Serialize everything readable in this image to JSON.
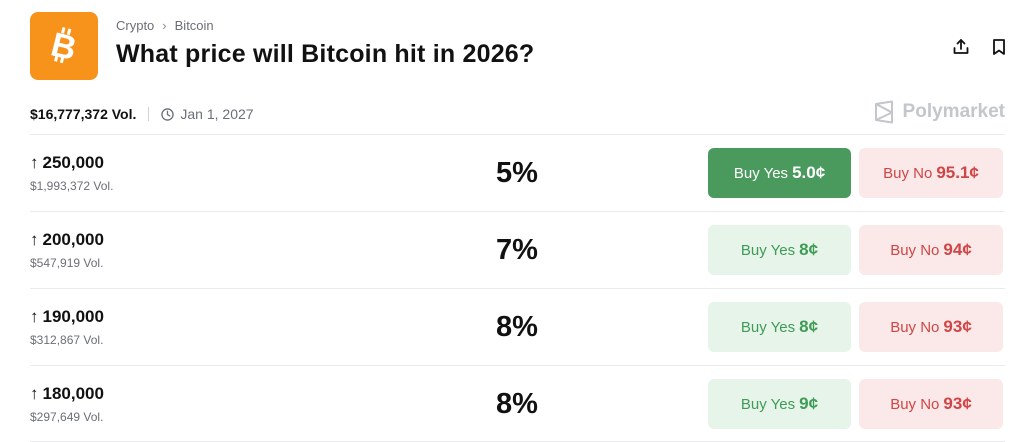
{
  "market": {
    "breadcrumb": [
      "Crypto",
      "Bitcoin"
    ],
    "title": "What price will Bitcoin hit in 2026?",
    "volume": "$16,777,372 Vol.",
    "end_date": "Jan 1, 2027",
    "brand": "Polymarket",
    "icons": {
      "logo": "bitcoin-logo-icon",
      "share": "share-icon",
      "bookmark": "bookmark-icon",
      "clock": "clock-icon",
      "brand": "polymarket-logo-icon",
      "arrow": "arrow-up-icon"
    }
  },
  "outcomes": [
    {
      "label": "250,000",
      "volume": "$1,993,372 Vol.",
      "chance": "5%",
      "yes_label": "Buy Yes",
      "yes_price": "5.0¢",
      "no_label": "Buy No",
      "no_price": "95.1¢",
      "selected": true
    },
    {
      "label": "200,000",
      "volume": "$547,919 Vol.",
      "chance": "7%",
      "yes_label": "Buy Yes",
      "yes_price": "8¢",
      "no_label": "Buy No",
      "no_price": "94¢",
      "selected": false
    },
    {
      "label": "190,000",
      "volume": "$312,867 Vol.",
      "chance": "8%",
      "yes_label": "Buy Yes",
      "yes_price": "8¢",
      "no_label": "Buy No",
      "no_price": "93¢",
      "selected": false
    },
    {
      "label": "180,000",
      "volume": "$297,649 Vol.",
      "chance": "8%",
      "yes_label": "Buy Yes",
      "yes_price": "9¢",
      "no_label": "Buy No",
      "no_price": "93¢",
      "selected": false
    }
  ],
  "colors": {
    "bitcoin_orange": "#f7931a",
    "yes_green": "#4a9a5e",
    "yes_green_light": "#e6f4ea",
    "no_red": "#d04545",
    "no_red_light": "#fbe9e9"
  }
}
